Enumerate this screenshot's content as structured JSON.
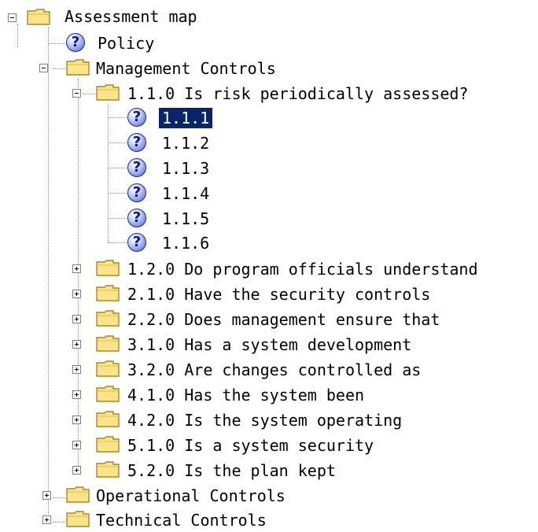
{
  "tree": {
    "root": {
      "label": "Assessment map",
      "expanded": true
    },
    "policy": {
      "label": "Policy"
    },
    "management": {
      "label": "Management Controls",
      "expanded": true
    },
    "q110": {
      "label": "1.1.0 Is risk periodically assessed?",
      "expanded": true
    },
    "items_110": [
      {
        "label": "1.1.1",
        "selected": true
      },
      {
        "label": "1.1.2"
      },
      {
        "label": "1.1.3"
      },
      {
        "label": "1.1.4"
      },
      {
        "label": "1.1.5"
      },
      {
        "label": "1.1.6"
      }
    ],
    "collapsed_mgmt": [
      {
        "label": "1.2.0 Do program officials understand"
      },
      {
        "label": "2.1.0 Have the security controls"
      },
      {
        "label": "2.2.0 Does management ensure that"
      },
      {
        "label": "3.1.0 Has a system development"
      },
      {
        "label": "3.2.0 Are changes controlled as"
      },
      {
        "label": "4.1.0 Has the system been"
      },
      {
        "label": "4.2.0 Is the system operating"
      },
      {
        "label": "5.1.0 Is a system security"
      },
      {
        "label": "5.2.0 Is the plan kept"
      }
    ],
    "operational": {
      "label": "Operational Controls",
      "expanded": false
    },
    "technical": {
      "label": "Technical Controls",
      "expanded": false
    }
  },
  "icons": {
    "folder": "folder-icon",
    "question": "question-icon"
  },
  "question_glyph": "?",
  "colors": {
    "selection": "#0a246a",
    "folder_fill": "#ffe38a",
    "folder_edge": "#a08a2a"
  }
}
